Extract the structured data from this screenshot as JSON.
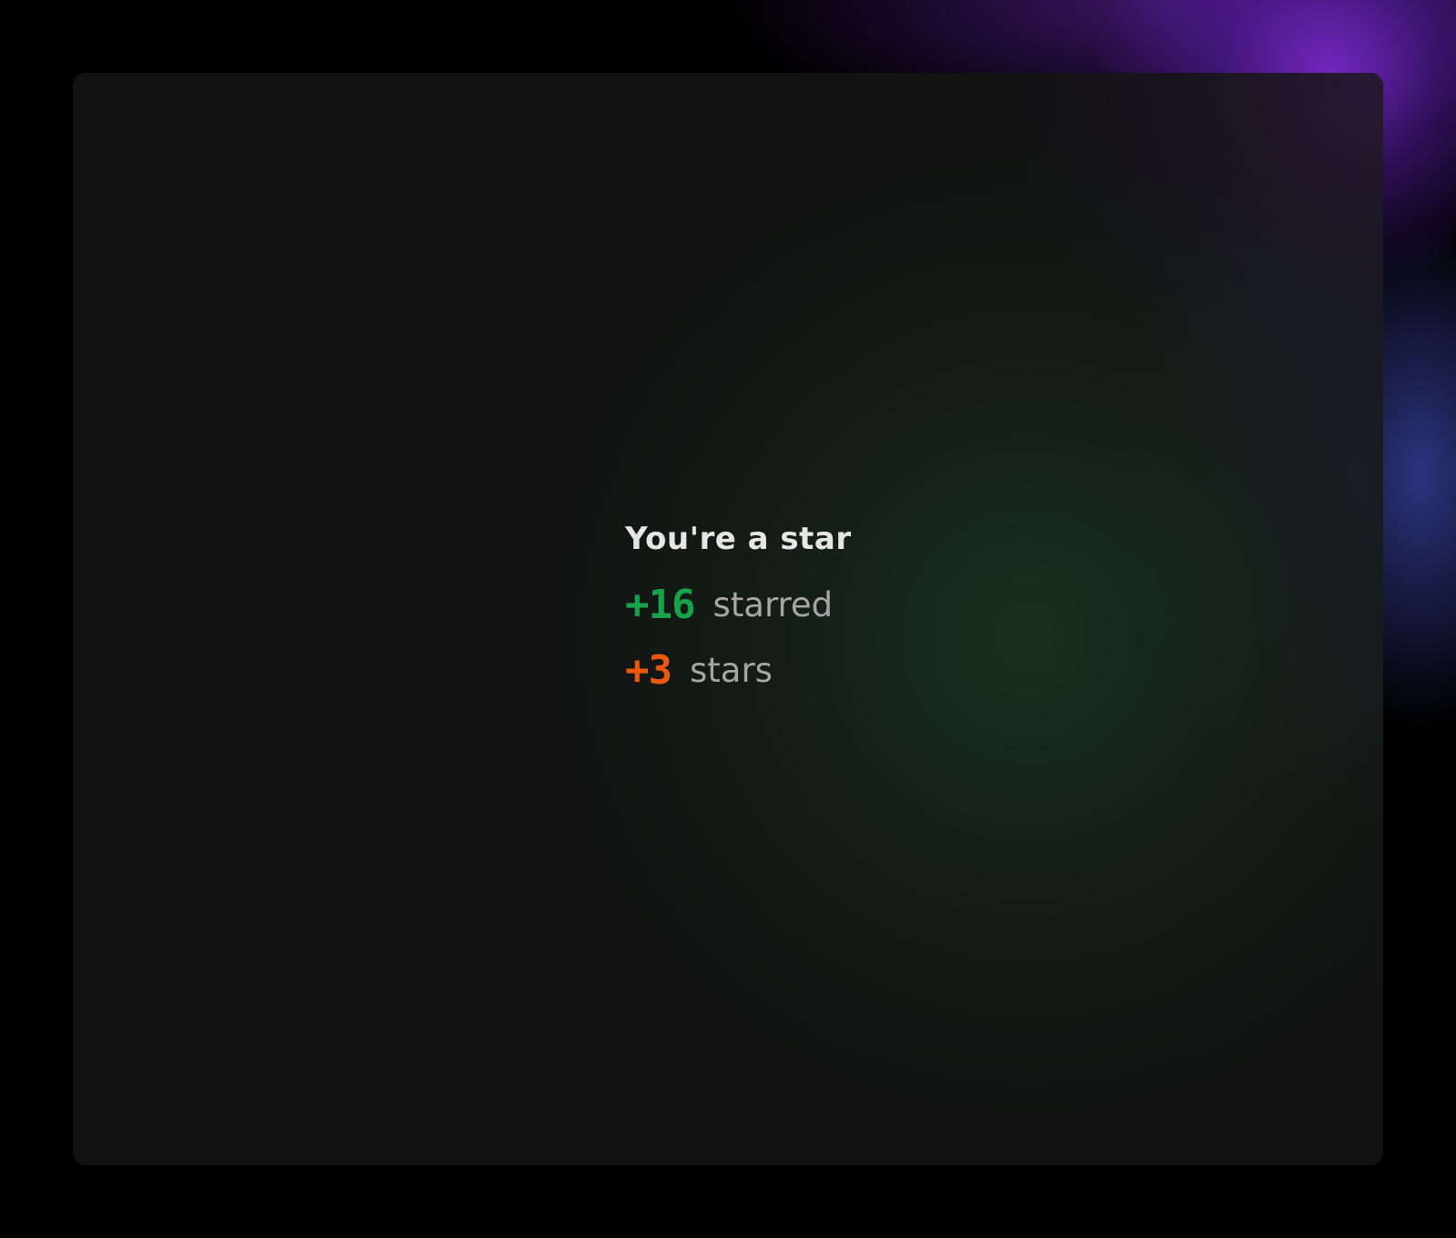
{
  "card": {
    "title": "You're a star",
    "stats": [
      {
        "value": "+16",
        "label": "starred",
        "color": "#17a34a"
      },
      {
        "value": "+3",
        "label": "stars",
        "color": "#ea580c"
      }
    ]
  },
  "colors": {
    "background": "#000000",
    "card": "#121212",
    "glow_purple": "#7828c8",
    "glow_blue": "#3c46aa",
    "title": "#e6e6e6",
    "label": "#a6a6a6"
  }
}
